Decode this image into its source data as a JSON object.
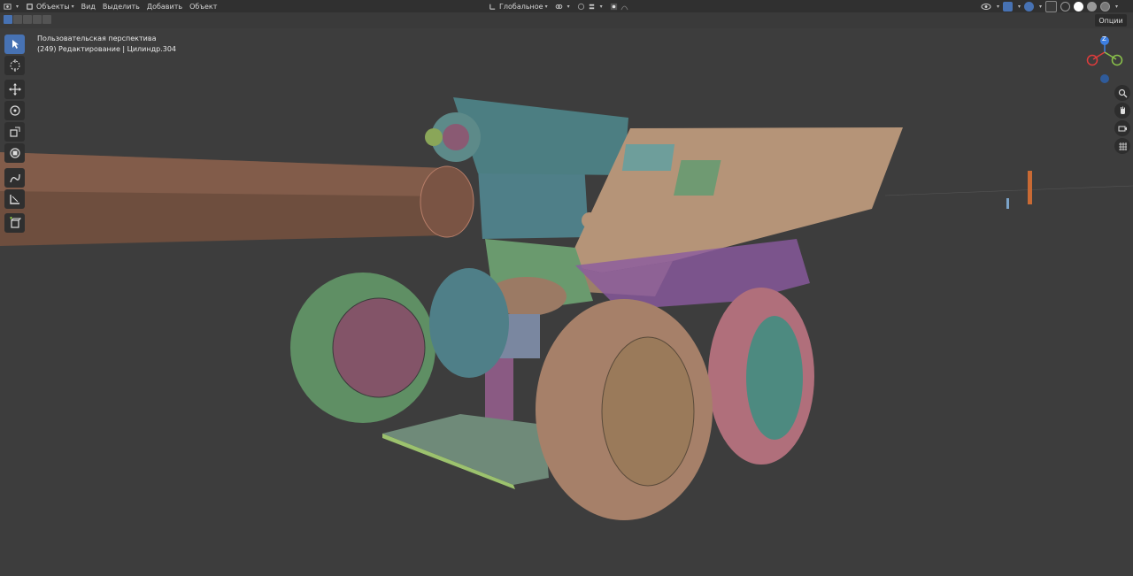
{
  "header": {
    "mode_label": "Объекты",
    "menu": [
      "Вид",
      "Выделить",
      "Добавить",
      "Объект"
    ],
    "transform_orientation": "Глобальное"
  },
  "options_label": "Опции",
  "viewport": {
    "view_name": "Пользовательская перспектива",
    "status_line": "(249) Редактирование | Цилиндр.304"
  },
  "gizmo": {
    "z_label": "Z"
  },
  "toolbar": {
    "tools": [
      "select-box-tool",
      "cursor-tool",
      "move-tool",
      "rotate-tool",
      "scale-tool",
      "transform-tool",
      "annotate-tool",
      "measure-tool",
      "add-cube-tool"
    ]
  },
  "colors": {
    "header_bg": "#303030",
    "viewport_bg": "#3d3d3d",
    "active_tool": "#4772b3",
    "axis_x": "#e03c3c",
    "axis_y": "#8bc34a",
    "axis_z": "#3d7ee0"
  }
}
